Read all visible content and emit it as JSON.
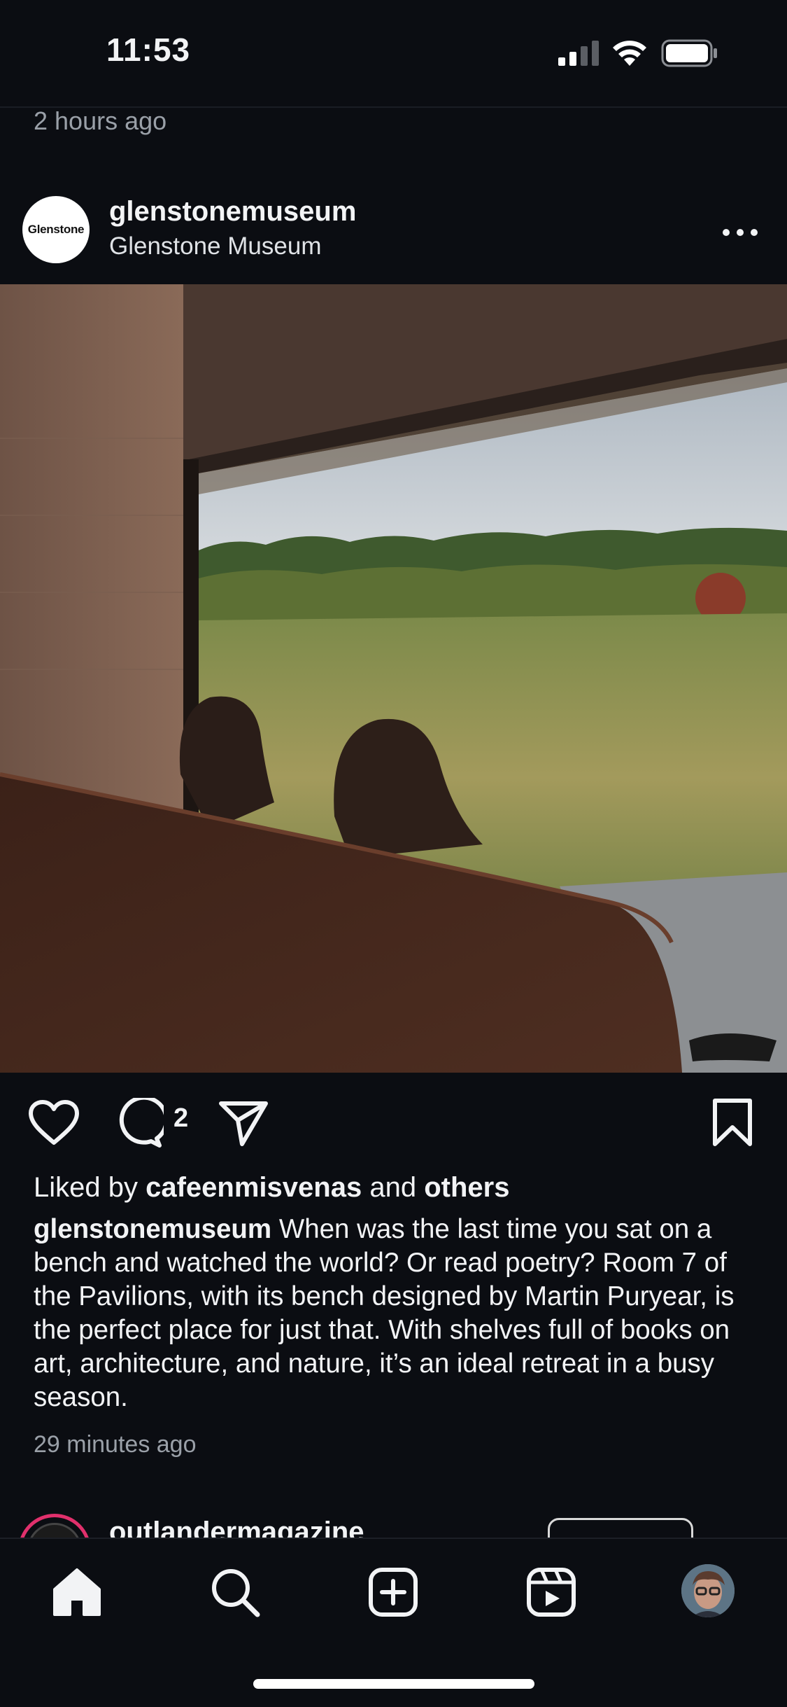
{
  "status_bar": {
    "time": "11:53"
  },
  "previous_post": {
    "time_ago": "2 hours ago"
  },
  "post": {
    "avatar_text": "Glenstone",
    "username": "glenstonemuseum",
    "subtitle": "Glenstone Museum",
    "comment_count": "2",
    "liked_by_prefix": "Liked by",
    "liked_by_user": "cafeenmisvenas",
    "liked_by_and": "and",
    "liked_by_others": "others",
    "caption_user": "glenstonemuseum",
    "caption_text": "When was the last time you sat on a bench and watched the world? Or read poetry? Room 7 of the Pavilions, with its bench designed by Martin Puryear, is the perfect place for just that. With shelves full of books on art, architecture, and nature, it’s an ideal retreat in a busy season.",
    "time_ago": "29 minutes ago"
  },
  "next_post": {
    "username": "outlandermagazine"
  },
  "tab_bar": {
    "items": [
      "home",
      "search",
      "create",
      "reels",
      "profile"
    ]
  },
  "colors": {
    "background": "#0b0d12",
    "text": "#f2f3f5",
    "muted": "#9aa0a8"
  }
}
